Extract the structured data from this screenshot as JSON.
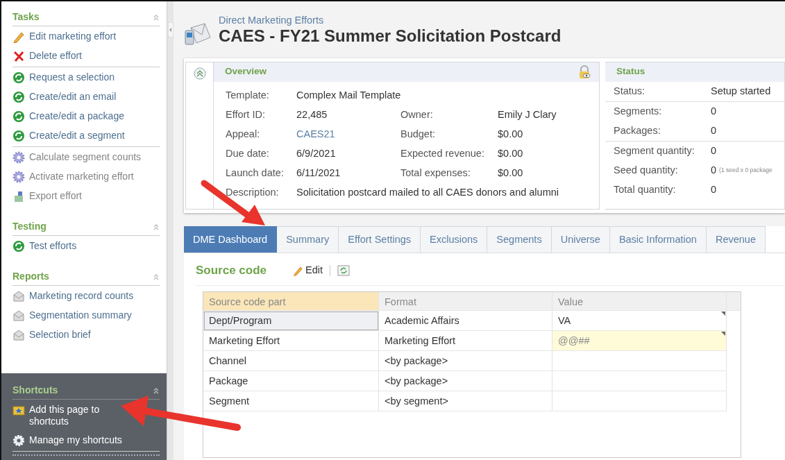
{
  "sidebar": {
    "sections": [
      {
        "title": "Tasks",
        "kind": "light",
        "groups": [
          [
            {
              "label": "Edit marketing effort",
              "kind": "pencil",
              "disabled": false
            },
            {
              "label": "Delete effort",
              "kind": "delete",
              "disabled": false
            }
          ],
          [
            {
              "label": "Request a selection",
              "kind": "refresh",
              "disabled": false
            },
            {
              "label": "Create/edit an email",
              "kind": "refresh",
              "disabled": false
            },
            {
              "label": "Create/edit a package",
              "kind": "refresh",
              "disabled": false
            },
            {
              "label": "Create/edit a segment",
              "kind": "refresh",
              "disabled": false
            }
          ],
          [
            {
              "label": "Calculate segment counts",
              "kind": "gear",
              "disabled": true
            },
            {
              "label": "Activate marketing effort",
              "kind": "gear",
              "disabled": true
            },
            {
              "label": "Export effort",
              "kind": "export",
              "disabled": true
            }
          ]
        ]
      },
      {
        "title": "Testing",
        "kind": "light",
        "groups": [
          [
            {
              "label": "Test efforts",
              "kind": "refresh",
              "disabled": false
            }
          ]
        ]
      },
      {
        "title": "Reports",
        "kind": "light",
        "groups": [
          [
            {
              "label": "Marketing record counts",
              "kind": "envelope",
              "disabled": false
            },
            {
              "label": "Segmentation summary",
              "kind": "envelope",
              "disabled": false
            },
            {
              "label": "Selection brief",
              "kind": "envelope",
              "disabled": false
            }
          ]
        ]
      },
      {
        "title": "Shortcuts",
        "kind": "dark",
        "groups": [
          [
            {
              "label": "Add this page to shortcuts",
              "kind": "star-folder",
              "disabled": false
            },
            {
              "label": "Manage my shortcuts",
              "kind": "cog",
              "disabled": false
            }
          ]
        ]
      }
    ]
  },
  "header": {
    "breadcrumb": "Direct Marketing Efforts",
    "title": "CAES - FY21 Summer Solicitation Postcard"
  },
  "overview": {
    "title": "Overview",
    "rows": [
      [
        {
          "label": "Template:",
          "value": "Complex Mail Template",
          "kind": "text"
        }
      ],
      [
        {
          "label": "Effort ID:",
          "value": "22,485",
          "kind": "text"
        },
        {
          "label": "Owner:",
          "value": "Emily J Clary",
          "kind": "text"
        }
      ],
      [
        {
          "label": "Appeal:",
          "value": "CAES21",
          "kind": "link"
        },
        {
          "label": "Budget:",
          "value": "$0.00",
          "kind": "text"
        }
      ],
      [
        {
          "label": "Due date:",
          "value": "6/9/2021",
          "kind": "text"
        },
        {
          "label": "Expected revenue:",
          "value": "$0.00",
          "kind": "text"
        }
      ],
      [
        {
          "label": "Launch date:",
          "value": "6/11/2021",
          "kind": "text"
        },
        {
          "label": "Total expenses:",
          "value": "$0.00",
          "kind": "text"
        }
      ],
      [
        {
          "label": "Description:",
          "value": "Solicitation postcard mailed to all CAES donors and alumni",
          "kind": "text"
        }
      ]
    ]
  },
  "status": {
    "title": "Status",
    "groups": [
      [
        {
          "label": "Status:",
          "value": "Setup started"
        }
      ],
      [
        {
          "label": "Segments:",
          "value": "0"
        },
        {
          "label": "Packages:",
          "value": "0"
        }
      ],
      [
        {
          "label": "Segment quantity:",
          "value": "0"
        },
        {
          "label": "Seed quantity:",
          "value": "0",
          "note": "(1 seed x 0 package"
        },
        {
          "label": "Total quantity:",
          "value": "0"
        }
      ]
    ]
  },
  "tabs": [
    {
      "label": "DME Dashboard",
      "selected": true
    },
    {
      "label": "Summary",
      "selected": false
    },
    {
      "label": "Effort Settings",
      "selected": false
    },
    {
      "label": "Exclusions",
      "selected": false
    },
    {
      "label": "Segments",
      "selected": false
    },
    {
      "label": "Universe",
      "selected": false
    },
    {
      "label": "Basic Information",
      "selected": false
    },
    {
      "label": "Revenue",
      "selected": false
    }
  ],
  "source_code": {
    "title": "Source code",
    "edit_button": "Edit",
    "table": {
      "columns": [
        {
          "label": "Source code part",
          "selected": true
        },
        {
          "label": "Format",
          "selected": false
        },
        {
          "label": "Value",
          "selected": false
        }
      ],
      "rows": [
        {
          "cells": [
            "Dept/Program",
            "Academic Affairs",
            "VA"
          ],
          "selected": true,
          "highlighted": false,
          "has_menu": true
        },
        {
          "cells": [
            "Marketing Effort",
            "Marketing Effort",
            "@@##"
          ],
          "selected": false,
          "highlighted": true,
          "has_menu": true
        },
        {
          "cells": [
            "Channel",
            "<by package>",
            ""
          ],
          "selected": false,
          "highlighted": false,
          "has_menu": false
        },
        {
          "cells": [
            "Package",
            "<by package>",
            ""
          ],
          "selected": false,
          "highlighted": false,
          "has_menu": false
        },
        {
          "cells": [
            "Segment",
            "<by segment>",
            ""
          ],
          "selected": false,
          "highlighted": false,
          "has_menu": false
        }
      ]
    }
  }
}
